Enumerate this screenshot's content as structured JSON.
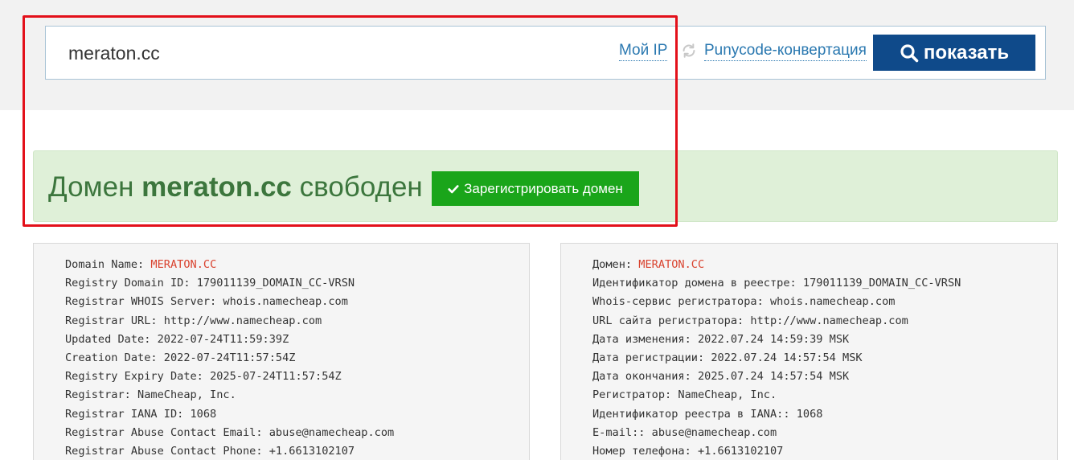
{
  "search": {
    "value": "meraton.cc",
    "my_ip_link": "Мой IP",
    "punycode_link": "Punycode-конвертация",
    "show_button": "показать"
  },
  "status": {
    "prefix": "Домен",
    "domain": "meraton.cc",
    "suffix": "свободен",
    "register_button": "Зарегистрировать домен"
  },
  "whois_en": [
    {
      "label": "Domain Name: ",
      "value": "MERATON.CC",
      "highlight": true
    },
    {
      "label": "Registry Domain ID: ",
      "value": "179011139_DOMAIN_CC-VRSN"
    },
    {
      "label": "Registrar WHOIS Server: ",
      "value": "whois.namecheap.com"
    },
    {
      "label": "Registrar URL: ",
      "value": "http://www.namecheap.com"
    },
    {
      "label": "Updated Date: ",
      "value": "2022-07-24T11:59:39Z"
    },
    {
      "label": "Creation Date: ",
      "value": "2022-07-24T11:57:54Z"
    },
    {
      "label": "Registry Expiry Date: ",
      "value": "2025-07-24T11:57:54Z"
    },
    {
      "label": "Registrar: ",
      "value": "NameCheap, Inc."
    },
    {
      "label": "Registrar IANA ID: ",
      "value": "1068"
    },
    {
      "label": "Registrar Abuse Contact Email: ",
      "value": "abuse@namecheap.com"
    },
    {
      "label": "Registrar Abuse Contact Phone: ",
      "value": "+1.6613102107"
    }
  ],
  "whois_ru": [
    {
      "label": "Домен: ",
      "value": "MERATON.CC",
      "highlight": true
    },
    {
      "label": "Идентификатор домена в реестре: ",
      "value": "179011139_DOMAIN_CC-VRSN"
    },
    {
      "label": "Whois-сервис регистратора: ",
      "value": "whois.namecheap.com"
    },
    {
      "label": "URL сайта регистратора: ",
      "value": "http://www.namecheap.com"
    },
    {
      "label": "Дата изменения: ",
      "value": "2022.07.24 14:59:39 MSK"
    },
    {
      "label": "Дата регистрации: ",
      "value": "2022.07.24 14:57:54 MSK"
    },
    {
      "label": "Дата окончания: ",
      "value": "2025.07.24 14:57:54 MSK"
    },
    {
      "label": "Регистратор: ",
      "value": "NameCheap, Inc."
    },
    {
      "label": "Идентификатор реестра в IANA:: ",
      "value": "1068"
    },
    {
      "label": "E-mail:: ",
      "value": "abuse@namecheap.com"
    },
    {
      "label": "Номер телефона: ",
      "value": "+1.6613102107"
    }
  ],
  "colors": {
    "primary_button": "#0f4a8a",
    "success_button": "#1aa51a",
    "success_bg": "#dff0d8",
    "success_text": "#3c763d",
    "link": "#2a78b0",
    "highlight_value": "#d9432f",
    "annotation_frame": "#e3101a"
  },
  "icons": {
    "refresh": "refresh-icon",
    "search": "search-icon",
    "check": "check-icon"
  }
}
